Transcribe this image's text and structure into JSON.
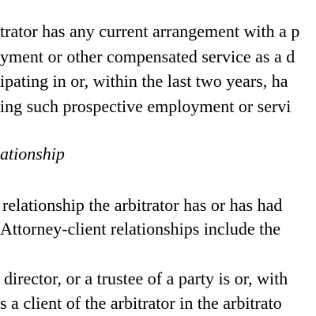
{
  "document": {
    "paragraph_1": {
      "lines": [
        "trator has any current arrangement with a p",
        "yment or other compensated service as a d",
        "ipating in or, within the last two years, ha",
        "ing such prospective employment or servi"
      ]
    },
    "heading": "ationship",
    "paragraph_2": {
      "lines": [
        "relationship the arbitrator has or has had",
        "Attorney-client relationships include the"
      ]
    },
    "paragraph_3": {
      "lines": [
        "director, or a trustee of a party is or, with",
        "s a client of the arbitrator in the arbitrato"
      ]
    }
  }
}
